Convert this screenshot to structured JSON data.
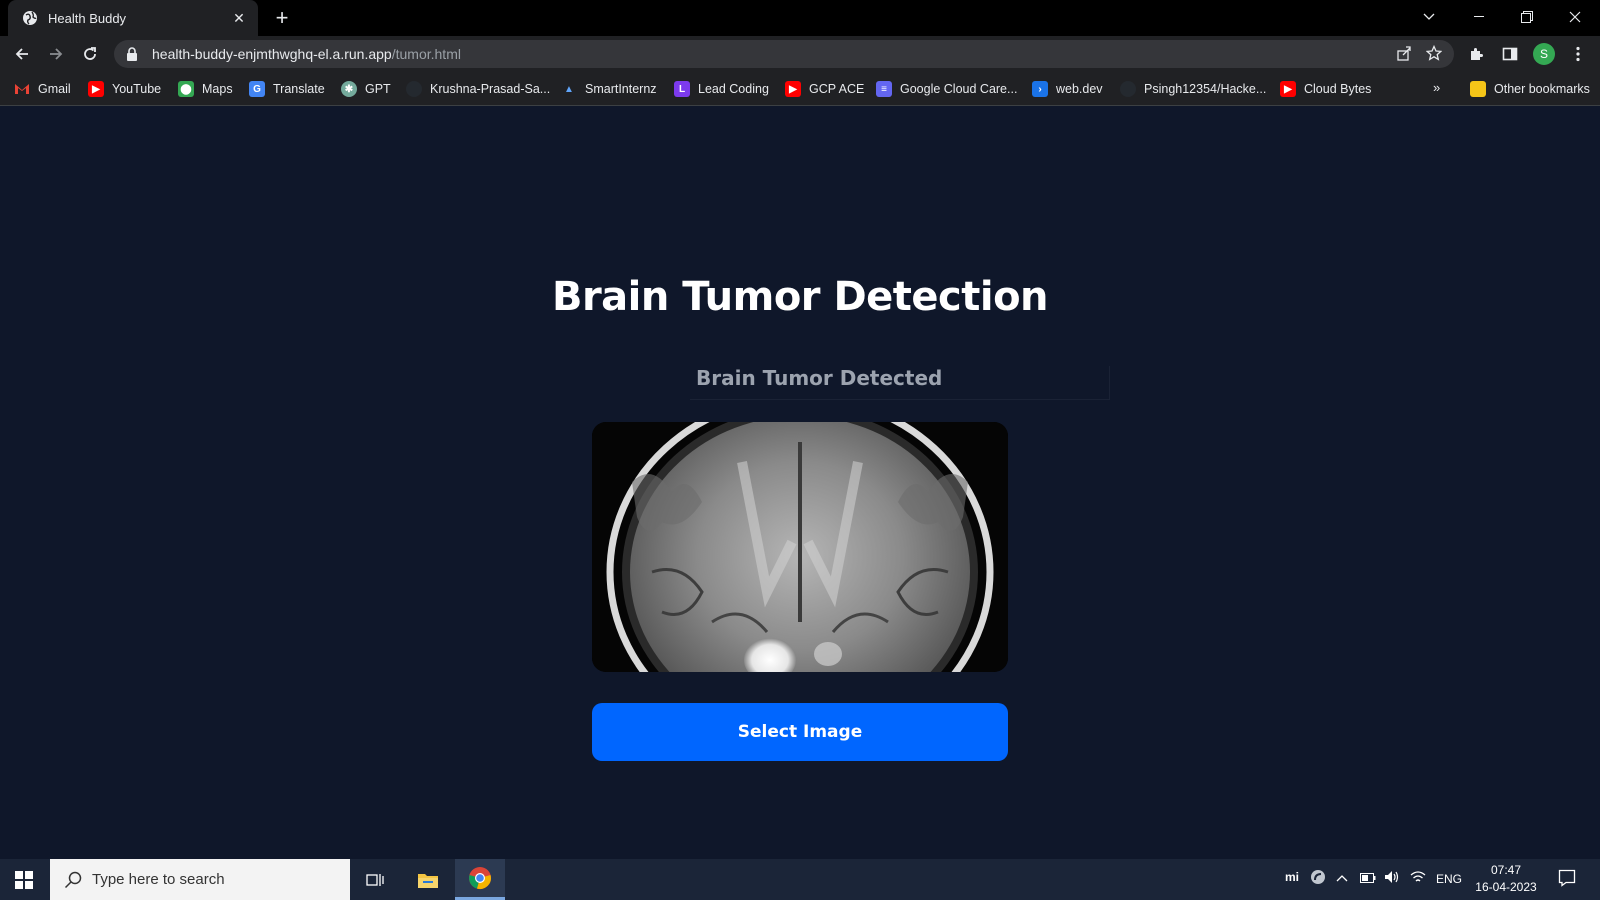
{
  "browser": {
    "tab_title": "Health Buddy",
    "url_host": "health-buddy-enjmthwghq-el.a.run.app",
    "url_path": "/tumor.html",
    "profile_initial": "S",
    "bookmarks": [
      {
        "label": "Gmail",
        "icon": "gmail-icon",
        "color": "#ea4335"
      },
      {
        "label": "YouTube",
        "icon": "youtube-icon",
        "color": "#ff0000"
      },
      {
        "label": "Maps",
        "icon": "maps-icon",
        "color": "#34a853"
      },
      {
        "label": "Translate",
        "icon": "translate-icon",
        "color": "#4285f4"
      },
      {
        "label": "GPT",
        "icon": "gpt-icon",
        "color": "#74aa9c"
      },
      {
        "label": "Krushna-Prasad-Sa...",
        "icon": "github-icon",
        "color": "#24292f"
      },
      {
        "label": "SmartInternz",
        "icon": "smartinternz-icon",
        "color": "#3b82f6"
      },
      {
        "label": "Lead Coding",
        "icon": "leadcoding-icon",
        "color": "#7c3aed"
      },
      {
        "label": "GCP ACE",
        "icon": "youtube-icon",
        "color": "#ff0000"
      },
      {
        "label": "Google Cloud Care...",
        "icon": "list-icon",
        "color": "#6366f1"
      },
      {
        "label": "web.dev",
        "icon": "webdev-icon",
        "color": "#1a73e8"
      },
      {
        "label": "Psingh12354/Hacke...",
        "icon": "github-icon",
        "color": "#24292f"
      },
      {
        "label": "Cloud Bytes",
        "icon": "youtube-icon",
        "color": "#ff0000"
      }
    ],
    "more_bookmarks": "»",
    "other_bookmarks": "Other bookmarks"
  },
  "page": {
    "title": "Brain Tumor Detection",
    "result": "Brain Tumor Detected",
    "select_button": "Select Image",
    "accent_color": "#0066ff"
  },
  "taskbar": {
    "search_placeholder": "Type here to search",
    "language": "ENG",
    "time": "07:47",
    "date": "16-04-2023"
  }
}
